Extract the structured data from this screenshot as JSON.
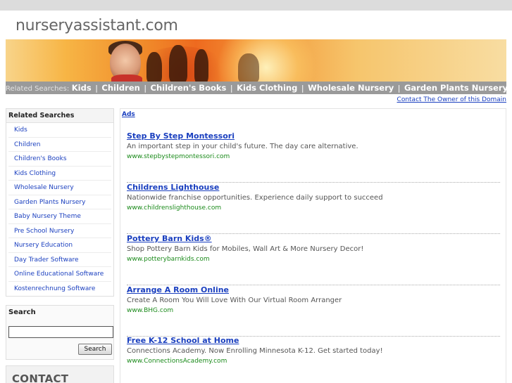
{
  "site": {
    "title": "nurseryassistant.com"
  },
  "navbar": {
    "label": "Related Searches:",
    "links": [
      "Kids",
      "Children",
      "Children's Books",
      "Kids Clothing",
      "Wholesale Nursery",
      "Garden Plants Nursery"
    ],
    "separator": "|"
  },
  "contact_owner": "Contact The Owner of this Domain",
  "sidebar": {
    "heading": "Related Searches",
    "items": [
      "Kids",
      "Children",
      "Children's Books",
      "Kids Clothing",
      "Wholesale Nursery",
      "Garden Plants Nursery",
      "Baby Nursery Theme",
      "Pre School Nursery",
      "Nursery Education",
      "Day Trader Software",
      "Online Educational Software",
      "Kostenrechnung Software"
    ]
  },
  "search": {
    "heading": "Search",
    "button_label": "Search",
    "value": ""
  },
  "contact": {
    "heading": "CONTACT"
  },
  "ads": {
    "label": "Ads",
    "items": [
      {
        "title": "Step By Step Montessori",
        "desc": "An important step in your child's future. The day care alternative.",
        "url": "www.stepbystepmontessori.com"
      },
      {
        "title": "Childrens Lighthouse",
        "desc": "Nationwide franchise opportunities. Experience daily support to succeed",
        "url": "www.childrenslighthouse.com"
      },
      {
        "title": "Pottery Barn Kids®",
        "desc": "Shop Pottery Barn Kids for Mobiles, Wall Art & More Nursery Decor!",
        "url": "www.potterybarnkids.com"
      },
      {
        "title": "Arrange A Room Online",
        "desc": "Create A Room You Will Love With Our Virtual Room Arranger",
        "url": "www.BHG.com"
      },
      {
        "title": "Free K-12 School at Home",
        "desc": "Connections Academy. Now Enrolling Minnesota K-12. Get started today!",
        "url": "www.ConnectionsAcademy.com"
      }
    ]
  },
  "colors": {
    "link": "#1a3fbf",
    "url_green": "#1a8a1a",
    "navbar_bg": "#9a9a9a"
  }
}
